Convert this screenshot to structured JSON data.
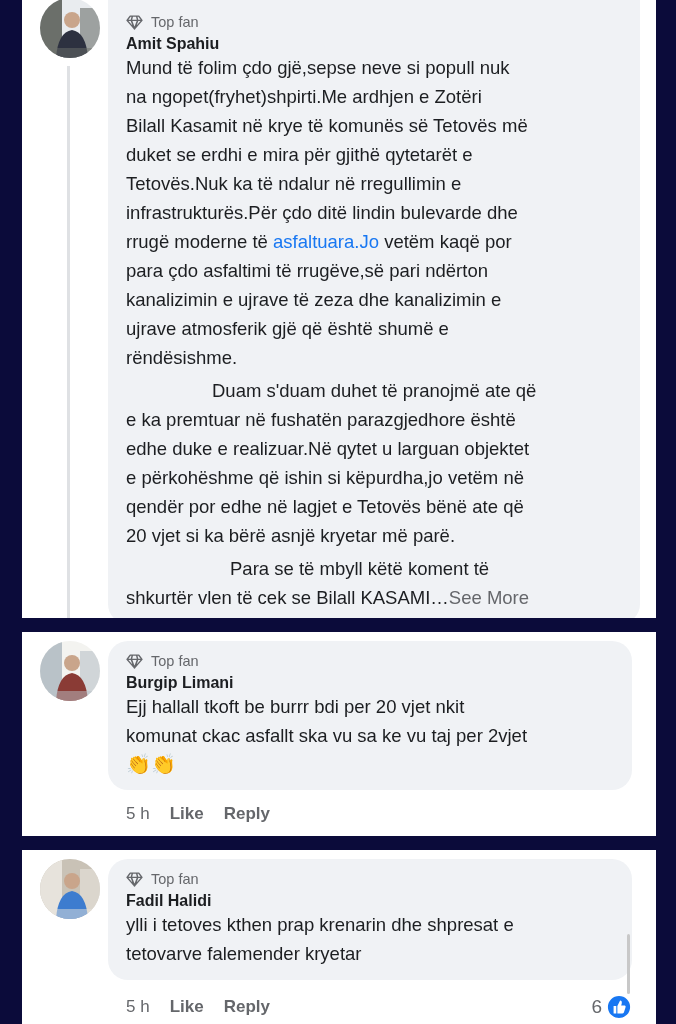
{
  "comments": [
    {
      "badge": "Top fan",
      "author": "Amit Spahiu",
      "thread_line": true,
      "paragraphs": [
        {
          "indented": false,
          "lines": [
            "Mund të folim çdo gjë,sepse neve si popull nuk",
            "na ngopet(fryhet)shpirti.Me ardhjen e Zotëri",
            "Bilall Kasamit në krye të komunës së Tetovës më",
            "duket se erdhi e mira për gjithë qytetarët e",
            "Tetovës.Nuk ka të ndalur në rregullimin e",
            "infrastrukturës.Për çdo ditë lindin bulevarde dhe",
            {
              "before": "rrugë moderne të ",
              "link": "asfaltuara.Jo",
              "after": " vetëm kaqë por"
            },
            "para çdo asfaltimi të rrugëve,së pari ndërton",
            "kanalizimin e ujrave të zeza dhe kanalizimin e",
            "ujrave atmosferik gjë që është shumë e",
            "rëndësishme."
          ]
        },
        {
          "indented": true,
          "lines": [
            "Duam s'duam duhet të pranojmë ate që",
            "e ka premtuar në fushatën parazgjedhore është",
            "edhe duke e realizuar.Në qytet u larguan objektet",
            "e përkohëshme që ishin  si këpurdha,jo vetëm në",
            "qendër por edhe në lagjet e Tetovës bënë ate që",
            "20 vjet si ka bërë asnjë kryetar më parë."
          ]
        },
        {
          "indented": true,
          "lines": [
            "Para se të mbyll këtë koment të",
            "shkurtër vlen të cek se Bilall KASAMI…"
          ]
        }
      ],
      "see_more": "See More"
    },
    {
      "badge": "Top fan",
      "author": "Burgip Limani",
      "thread_line": false,
      "paragraphs": [
        {
          "indented": false,
          "lines": [
            "Ejj hallall tkoft be burrr bdi per 20 vjet nkit",
            "komunat ckac asfallt ska vu sa ke vu taj per 2vjet"
          ]
        }
      ],
      "emoji": "👏👏",
      "time": "5 h",
      "actions": [
        "Like",
        "Reply"
      ]
    },
    {
      "badge": "Top fan",
      "author": "Fadil Halidi",
      "thread_line": false,
      "paragraphs": [
        {
          "indented": false,
          "lines": [
            "ylli i tetoves kthen prap krenarin dhe  shpresat e",
            "tetovarve falemender kryetar"
          ]
        }
      ],
      "time": "5 h",
      "actions": [
        "Like",
        "Reply"
      ],
      "reactions": "6",
      "scrollbar": true
    }
  ]
}
